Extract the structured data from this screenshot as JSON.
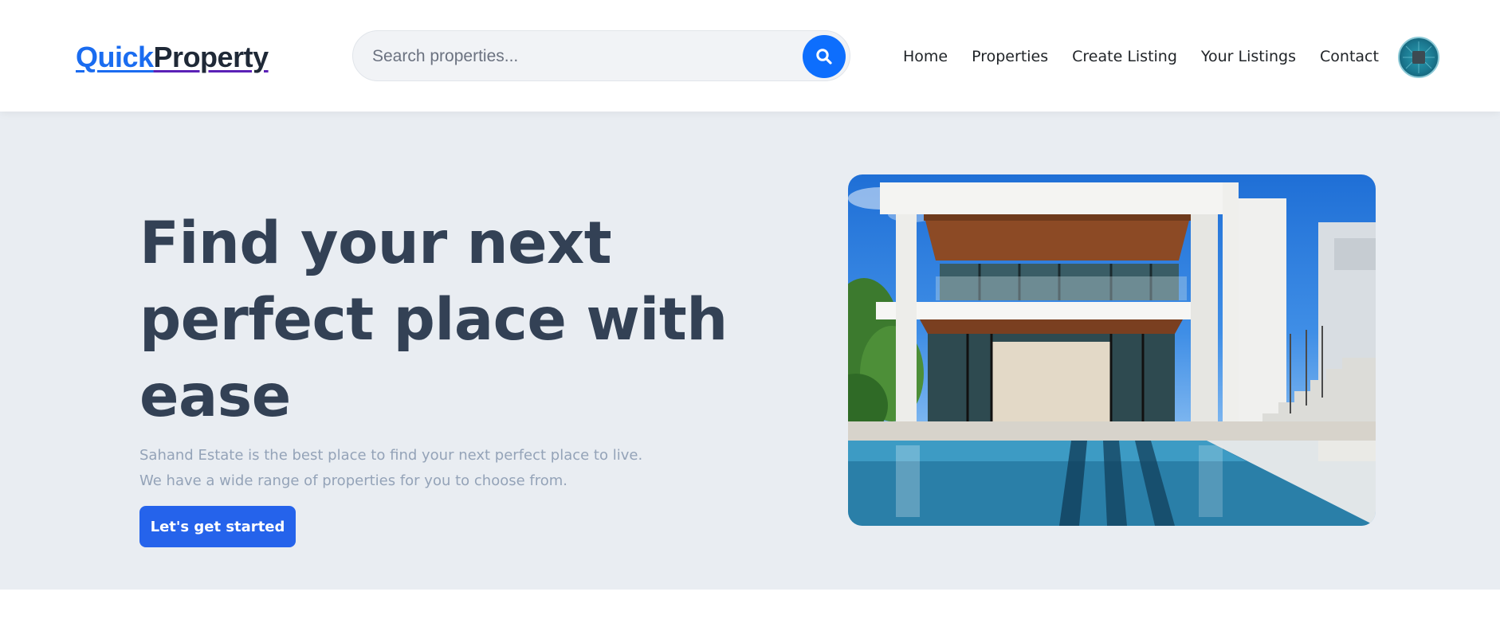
{
  "header": {
    "logo": {
      "part1": "Quick",
      "part2": "Property"
    },
    "search": {
      "placeholder": "Search properties...",
      "value": "",
      "icon": "search-icon"
    },
    "nav": [
      {
        "label": "Home"
      },
      {
        "label": "Properties"
      },
      {
        "label": "Create Listing"
      },
      {
        "label": "Your Listings"
      },
      {
        "label": "Contact"
      }
    ],
    "avatar": {
      "icon": "avatar-icon"
    }
  },
  "hero": {
    "title": "Find your next perfect place with ease",
    "subtitle_line1": "Sahand Estate is the best place to find your next perfect place to live.",
    "subtitle_line2": "We have a wide range of properties for you to choose from.",
    "cta_label": "Let's get started",
    "image": "modern-house-with-pool"
  },
  "colors": {
    "brand_blue": "#1a6cf0",
    "brand_purple": "#5b21b6",
    "cta_blue": "#2563eb",
    "search_button": "#0d6efd",
    "hero_background": "#e9edf2",
    "title_color": "#334155",
    "subtitle_color": "#94a3b8"
  }
}
